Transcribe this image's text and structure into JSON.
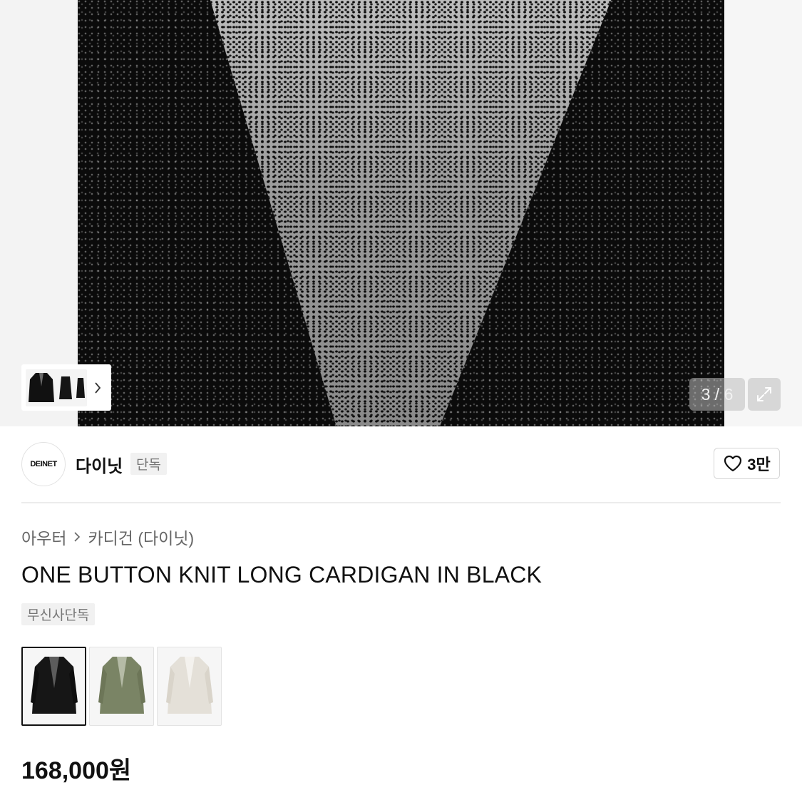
{
  "gallery": {
    "counter": "3 / 6",
    "expand_icon": "expand-icon",
    "mini_gallery_chevron": "chevron-right-icon"
  },
  "brand": {
    "logo_text": "DEINET",
    "name": "다이닛",
    "tag": "단독",
    "likes": "3만"
  },
  "breadcrumb": {
    "level1": "아우터",
    "level2": "카디건 (다이닛)"
  },
  "product": {
    "title": "ONE BUTTON KNIT LONG CARDIGAN IN BLACK",
    "badge": "무신사단독",
    "price": "168,000원",
    "colors": [
      {
        "color": "#1a1a1a",
        "selected": true
      },
      {
        "color": "#7a8465",
        "selected": false
      },
      {
        "color": "#e4e0d8",
        "selected": false
      }
    ]
  }
}
